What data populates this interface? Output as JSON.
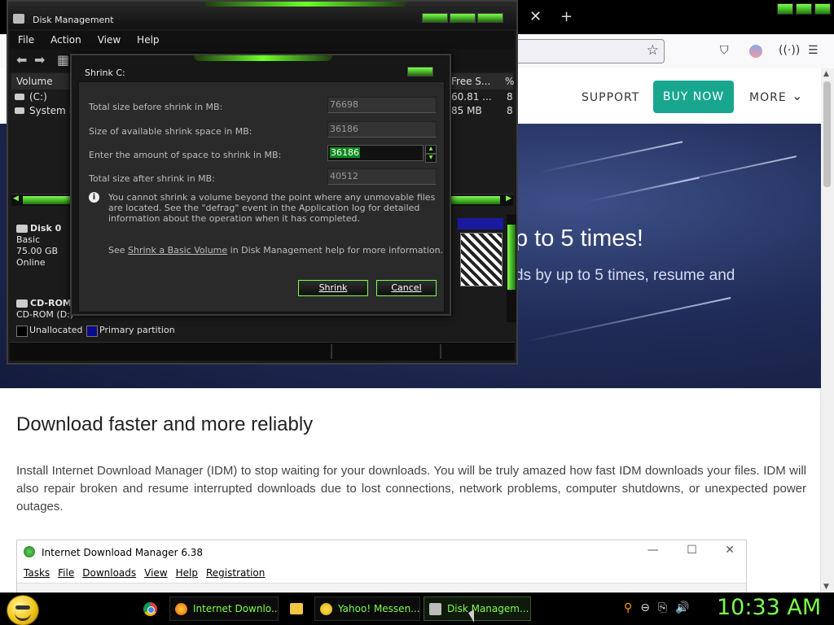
{
  "browser": {
    "tab_close": "✕",
    "tab_new": "+"
  },
  "site": {
    "nav": {
      "support": "SUPPORT",
      "buy_now": "BUY NOW",
      "more": "MORE"
    },
    "hero_title": "p to 5 times!",
    "hero_subtitle": "ds by up to 5 times, resume and",
    "section_heading": "Download faster and more reliably",
    "section_paragraph": "Install Internet Download Manager (IDM) to stop waiting for your downloads. You will be truly amazed how fast IDM downloads your files. IDM will also repair broken and resume interrupted downloads due to lost connections, network problems, computer shutdowns, or unexpected power outages.",
    "idm_window": {
      "title": "Internet Download Manager 6.38",
      "menu": [
        "Tasks",
        "File",
        "Downloads",
        "View",
        "Help",
        "Registration"
      ]
    }
  },
  "disk_management": {
    "title": "Disk Management",
    "menu": [
      "File",
      "Action",
      "View",
      "Help"
    ],
    "columns": {
      "volume": "Volume",
      "free_space": "Free S...",
      "pct": "%"
    },
    "volumes": [
      {
        "name": "(C:)",
        "free": "60.81 ...",
        "pct": "8"
      },
      {
        "name": "System I",
        "free": "85 MB",
        "pct": "8"
      }
    ],
    "disks": [
      {
        "name": "Disk 0",
        "type": "Basic",
        "size": "75.00 GB",
        "status": "Online"
      },
      {
        "name": "CD-ROM",
        "type": "CD-ROM (D:)"
      }
    ],
    "legend": {
      "unallocated": "Unallocated",
      "primary": "Primary partition"
    },
    "colors": {
      "unallocated": "#000000",
      "primary": "#0a0a8c",
      "accent": "#7cff4a"
    }
  },
  "shrink_dialog": {
    "title": "Shrink C:",
    "total_before_label": "Total size before shrink in MB:",
    "total_before_value": "76698",
    "available_label": "Size of available shrink space in MB:",
    "available_value": "36186",
    "amount_label": "Enter the amount of space to shrink in MB:",
    "amount_value": "36186",
    "total_after_label": "Total size after shrink in MB:",
    "total_after_value": "40512",
    "info_text": "You cannot shrink a volume beyond the point where any unmovable files are located. See the \"defrag\" event in the Application log for detailed information about the operation when it has completed.",
    "help_prefix": "See ",
    "help_link": "Shrink a Basic Volume",
    "help_suffix": " in Disk Management help for more information.",
    "shrink_button": "Shrink",
    "cancel_button": "Cancel"
  },
  "taskbar": {
    "items": [
      {
        "label": "Internet Downlo...",
        "icon": "firefox-icon"
      },
      {
        "label": "Yahoo! Messen...",
        "icon": "yahoo-icon"
      },
      {
        "label": "Disk Managem...",
        "icon": "disk-icon"
      }
    ],
    "clock": "10:33 AM"
  }
}
